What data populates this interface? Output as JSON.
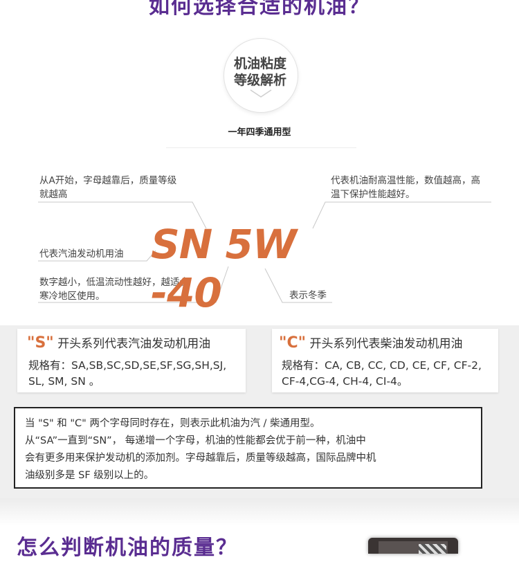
{
  "header": {
    "title": "如何选择合适的机油？"
  },
  "badge": {
    "line1": "机油粘度",
    "line2": "等级解析"
  },
  "subtitle": "一年四季通用型",
  "annotations": {
    "grade_letter": {
      "line1": "从A开始，字母越靠后，质量等级",
      "line2": "就越高"
    },
    "high_temp": {
      "line1": "代表机油耐高温性能，数值越高，高",
      "line2": "温下保护性能越好。"
    },
    "gasoline": "代表汽油发动机用油",
    "low_temp": {
      "line1": "数字越小，低温流动性越好，越适合",
      "line2": "寒冷地区使用。"
    },
    "winter": "表示冬季"
  },
  "grade_code": "SN 5W -40",
  "cards": [
    {
      "letter": "\"S\"",
      "head": "开头系列代表汽油发动机用油",
      "body_line1": "规格有：SA,SB,SC,SD,SE,SF,SG,SH,SJ,",
      "body_line2": "SL,  SM,  SN 。"
    },
    {
      "letter": "\"C\"",
      "head": "开头系列代表柴油发动机用油",
      "body_line1": "规格有：CA, CB, CC, CD, CE, CF, CF-2,",
      "body_line2": "CF-4,CG-4, CH-4, CI-4。"
    }
  ],
  "note": {
    "line1": "当 \"S\" 和 \"C\" 两个字母同时存在，则表示此机油为汽 / 柴通用型。",
    "line2": "从“SA”一直到“SN”， 每递增一个字母，机油的性能都会优于前一种，机油中",
    "line3": "会有更多用来保护发动机的添加剂。字母越靠后，质量等级越高，国际品牌中机",
    "line4": "油级别多是 SF 级别以上的。"
  },
  "section2": {
    "title": "怎么判断机油的质量？"
  },
  "colors": {
    "purple": "#5a2d91",
    "orange": "#d8703d",
    "line": "#c8c8c8",
    "band": "#efefef"
  }
}
